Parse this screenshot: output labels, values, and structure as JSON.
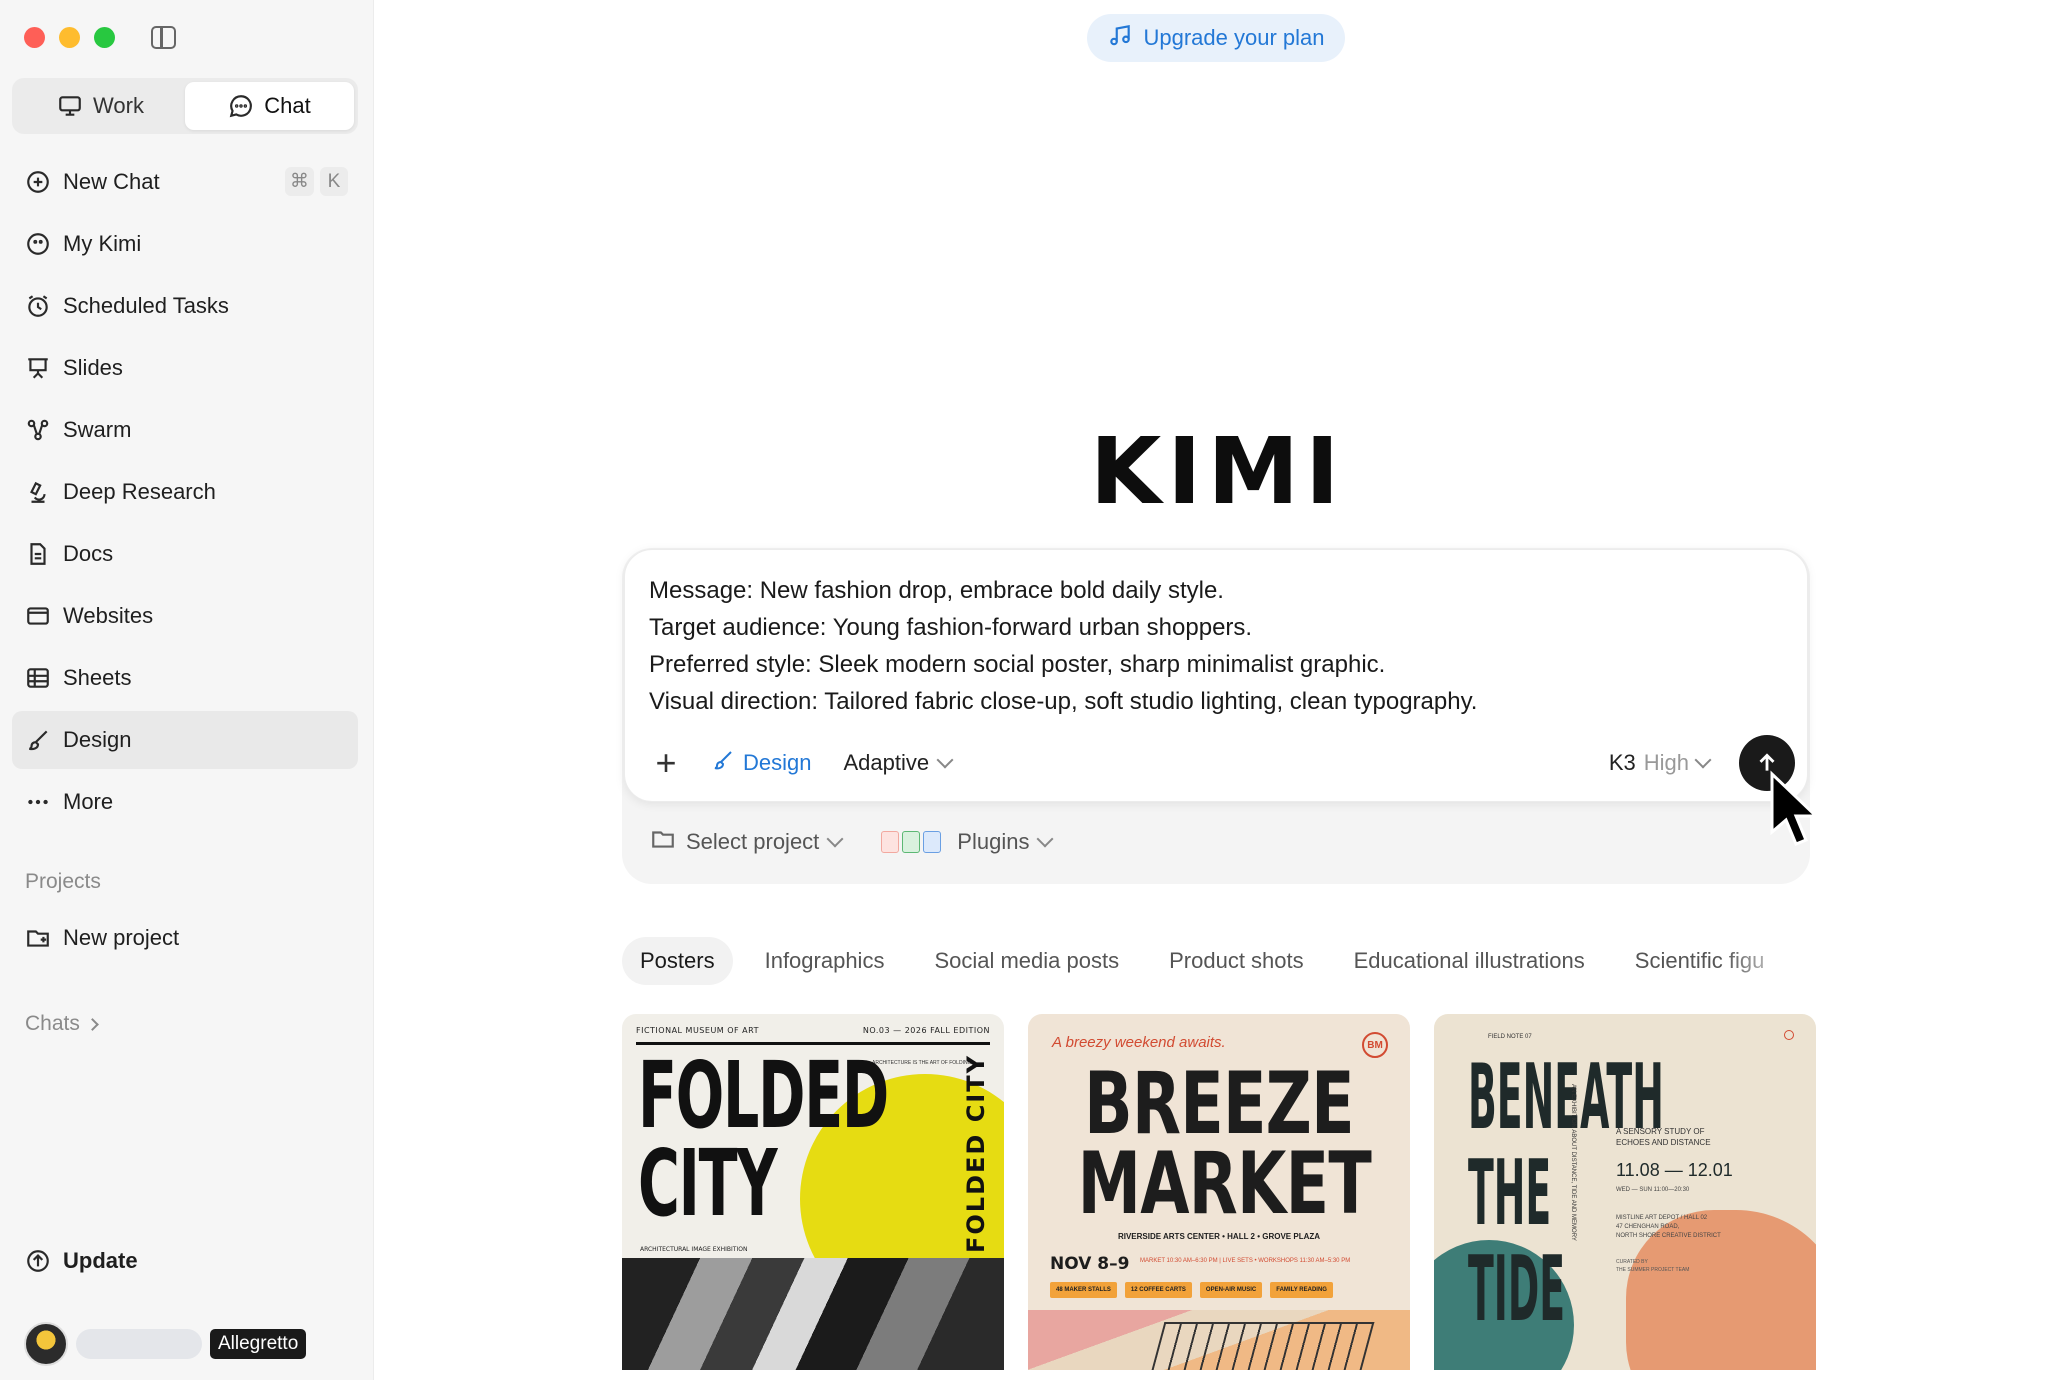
{
  "sidebar": {
    "modes": [
      {
        "label": "Work",
        "icon": "monitor-icon",
        "active": false
      },
      {
        "label": "Chat",
        "icon": "chat-bubble-icon",
        "active": true
      }
    ],
    "items": [
      {
        "label": "New Chat",
        "icon": "new-chat-icon",
        "shortcut": [
          "⌘",
          "K"
        ]
      },
      {
        "label": "My Kimi",
        "icon": "face-icon"
      },
      {
        "label": "Scheduled Tasks",
        "icon": "alarm-clock-icon"
      },
      {
        "label": "Slides",
        "icon": "presentation-icon"
      },
      {
        "label": "Swarm",
        "icon": "swarm-icon"
      },
      {
        "label": "Deep Research",
        "icon": "microscope-icon"
      },
      {
        "label": "Docs",
        "icon": "document-icon"
      },
      {
        "label": "Websites",
        "icon": "browser-window-icon"
      },
      {
        "label": "Sheets",
        "icon": "table-icon"
      },
      {
        "label": "Design",
        "icon": "brush-icon",
        "active": true
      },
      {
        "label": "More",
        "icon": "more-dots-icon"
      }
    ],
    "projects_label": "Projects",
    "new_project_label": "New project",
    "chats_label": "Chats",
    "update_label": "Update",
    "plan_badge": "Allegretto"
  },
  "header": {
    "upgrade_label": "Upgrade your plan"
  },
  "main": {
    "logo_text": "KIMI",
    "composer": {
      "prompt_lines": "Message: New fashion drop, embrace bold daily style.\nTarget audience: Young fashion-forward urban shoppers.\nPreferred style: Sleek modern social poster, sharp minimalist graphic.\nVisual direction: Tailored fabric close-up, soft studio lighting, clean typography.",
      "design_label": "Design",
      "adaptive_label": "Adaptive",
      "model_label": "K3",
      "effort_label": "High"
    },
    "project_select_label": "Select project",
    "plugins_label": "Plugins",
    "tabs": [
      {
        "label": "Posters",
        "active": true
      },
      {
        "label": "Infographics"
      },
      {
        "label": "Social media posts"
      },
      {
        "label": "Product shots"
      },
      {
        "label": "Educational illustrations"
      },
      {
        "label": "Scientific figu"
      }
    ],
    "cards": {
      "folded_city": {
        "meta_left": "FICTIONAL MUSEUM OF ART",
        "meta_right": "NO.03 — 2026 FALL EDITION",
        "title": "FOLDED\nCITY",
        "vertical": "FOLDED CITY",
        "tagline": "ARCHITECTURE IS THE ART OF FOLDING",
        "caption": "ARCHITECTURAL IMAGE EXHIBITION"
      },
      "breeze_market": {
        "intro": "A breezy weekend awaits.",
        "badge": "BM",
        "title": "BREEZE\nMARKET",
        "venue": "RIVERSIDE ARTS CENTER • HALL 2 • GROVE PLAZA",
        "date": "NOV 8–9",
        "info": "MARKET 10:30 AM–6:30 PM | LIVE SETS • WORKSHOPS 11:30 AM–5:30 PM",
        "chips": [
          "48 MAKER STALLS",
          "12 COFFEE CARTS",
          "OPEN-AIR MUSIC",
          "FAMILY READING"
        ]
      },
      "beneath_the_tide": {
        "field_note": "FIELD NOTE 07",
        "title": "BENEATH\nTHE\nTIDE",
        "vertical": "AN EXHIBITION ABOUT DISTANCE, TIDE AND MEMORY",
        "study": "A SENSORY STUDY OF\nECHOES AND DISTANCE",
        "dates": "11.08 — 12.01",
        "hours": "WED — SUN 11:00—20:30",
        "venue": "MISTLINE ART DEPOT / HALL 02\n47 CHENGHAN ROAD,\nNORTH SHORE CREATIVE DISTRICT",
        "curated": "CURATED BY\nTHE SUMMER PROJECT TEAM"
      }
    }
  },
  "colors": {
    "accent_blue": "#2378d6",
    "sidebar_bg": "#f6f6f6",
    "send_button": "#1a1a1a"
  }
}
